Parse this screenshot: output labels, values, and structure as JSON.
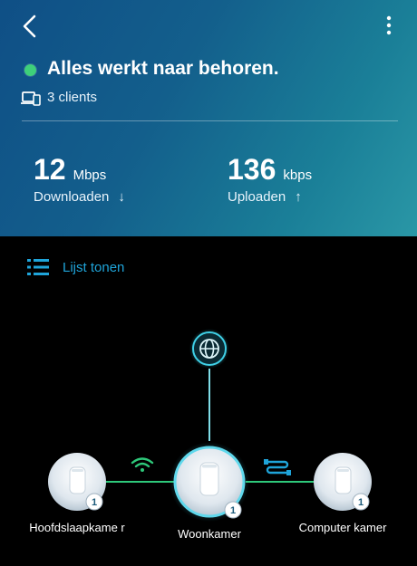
{
  "header": {
    "status_text": "Alles werkt naar behoren.",
    "status_color": "#3ed07a",
    "clients_text": "3 clients",
    "back_icon": "chevron-left-icon",
    "more_icon": "more-vertical-icon"
  },
  "speeds": {
    "download": {
      "value": "12",
      "unit": "Mbps",
      "label": "Downloaden",
      "arrow": "↓"
    },
    "upload": {
      "value": "136",
      "unit": "kbps",
      "label": "Uploaden",
      "arrow": "↑"
    }
  },
  "list_toggle": {
    "label": "Lijst tonen",
    "icon": "list-icon"
  },
  "topology": {
    "internet_icon": "globe-icon",
    "nodes": [
      {
        "label": "Hoofdslaapkame r",
        "badge": "1",
        "connection": "wifi"
      },
      {
        "label": "Woonkamer",
        "badge": "1",
        "connection": "main"
      },
      {
        "label": "Computer kamer",
        "badge": "1",
        "connection": "ethernet"
      }
    ],
    "accent_color": "#2ec87a",
    "link_color": "#38d0e0"
  }
}
